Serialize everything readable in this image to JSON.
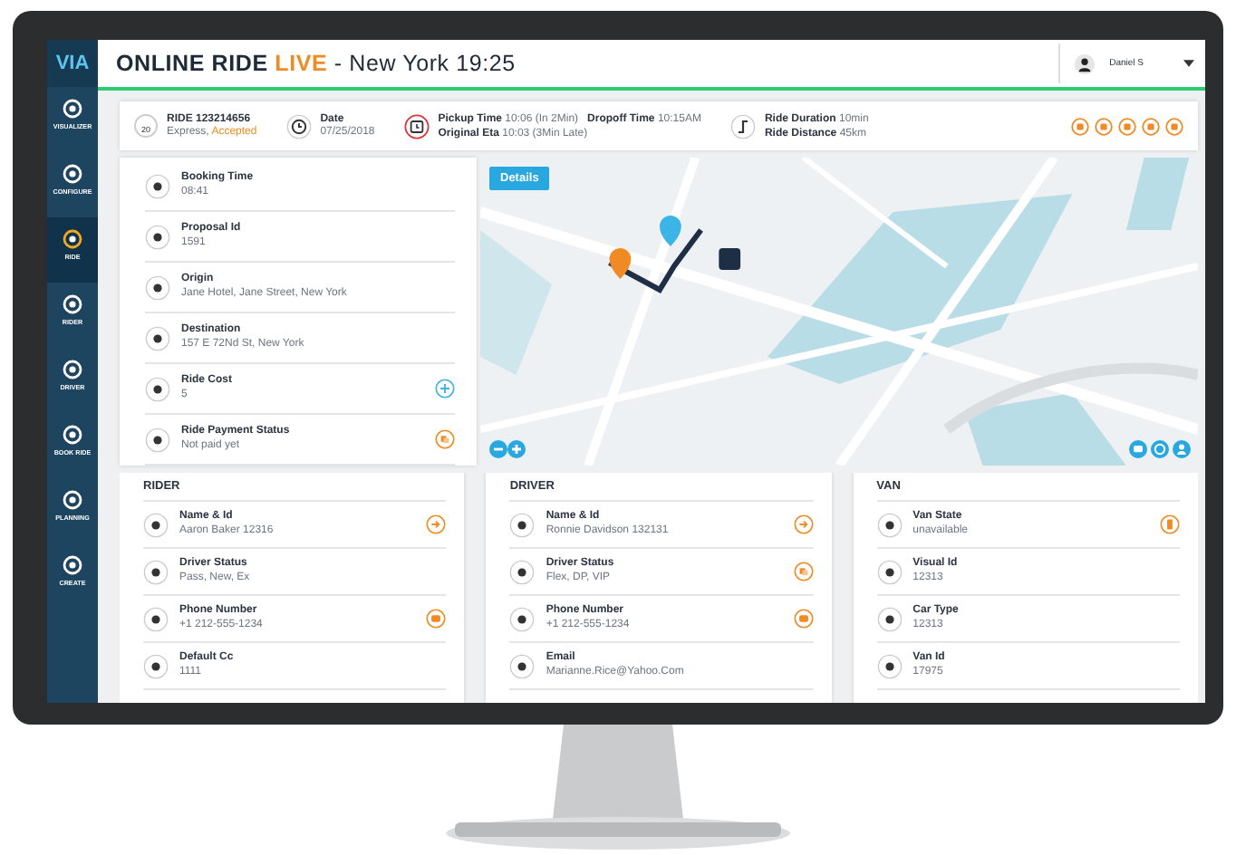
{
  "logo": "VIA",
  "sidebar": {
    "items": [
      {
        "label": "VISUALIZER",
        "selected": false
      },
      {
        "label": "CONFIGURE",
        "selected": false
      },
      {
        "label": "RIDE",
        "selected": true
      },
      {
        "label": "RIDER",
        "selected": false
      },
      {
        "label": "DRIVER",
        "selected": false
      },
      {
        "label": "BOOK RIDE",
        "selected": false
      },
      {
        "label": "PLANNING",
        "selected": false
      },
      {
        "label": "CREATE",
        "selected": false
      }
    ]
  },
  "header": {
    "title": "ONLINE RIDE",
    "live": "LIVE",
    "subtitle": "- New York 19:25",
    "user": "Daniel S"
  },
  "ride_bar": {
    "ride_id": "RIDE 123214656",
    "seats": "20",
    "ride_type": "Express,",
    "ride_status": "Accepted",
    "date_label": "Date",
    "date": "07/25/2018",
    "pickup_label": "Pickup Time",
    "pickup": "10:06 (In 2Min)",
    "dropoff_label": "Dropoff Time",
    "dropoff": "10:15AM",
    "eta_label": "Original Eta",
    "eta": "10:03 (3Min Late)",
    "duration_label": "Ride Duration",
    "duration": "10min",
    "distance_label": "Ride Distance",
    "distance": "45km"
  },
  "details": [
    {
      "label": "Booking Time",
      "value": "08:41",
      "kind": "plain"
    },
    {
      "label": "Proposal Id",
      "value": "1591",
      "kind": "plain"
    },
    {
      "label": "Origin",
      "value": "Jane Hotel, Jane Street, New York",
      "kind": "plain"
    },
    {
      "label": "Destination",
      "value": "157 E 72Nd St, New York",
      "kind": "plain"
    },
    {
      "label": "Ride Cost",
      "value": "5",
      "kind": "add"
    },
    {
      "label": "Ride Payment Status",
      "value": "Not paid yet",
      "kind": "pay"
    }
  ],
  "map": {
    "kind": "picture",
    "button": "Details"
  },
  "cards": [
    {
      "title": "RIDER",
      "rows": [
        {
          "label": "Name & Id",
          "value": "Aaron Baker 12316",
          "kind": "forward"
        },
        {
          "label": "Driver Status",
          "value": "Pass, New, Ex",
          "kind": "plain"
        },
        {
          "label": "Phone Number",
          "value": "+1 212-555-1234",
          "kind": "chat"
        },
        {
          "label": "Default Cc",
          "value": "1111",
          "kind": "plain"
        }
      ]
    },
    {
      "title": "DRIVER",
      "rows": [
        {
          "label": "Name & Id",
          "value": "Ronnie Davidson 132131",
          "kind": "forward"
        },
        {
          "label": "Driver Status",
          "value": "Flex, DP, VIP",
          "kind": "pay"
        },
        {
          "label": "Phone Number",
          "value": "+1 212-555-1234",
          "kind": "chat"
        },
        {
          "label": "Email",
          "value": "Marianne.Rice@Yahoo.Com",
          "kind": "plain"
        }
      ]
    },
    {
      "title": "VAN",
      "rows": [
        {
          "label": "Van State",
          "value": "unavailable",
          "kind": "device"
        },
        {
          "label": "Visual Id",
          "value": "12313",
          "kind": "plain"
        },
        {
          "label": "Car Type",
          "value": "12313",
          "kind": "plain"
        },
        {
          "label": "Van Id",
          "value": "17975",
          "kind": "plain"
        }
      ]
    }
  ]
}
